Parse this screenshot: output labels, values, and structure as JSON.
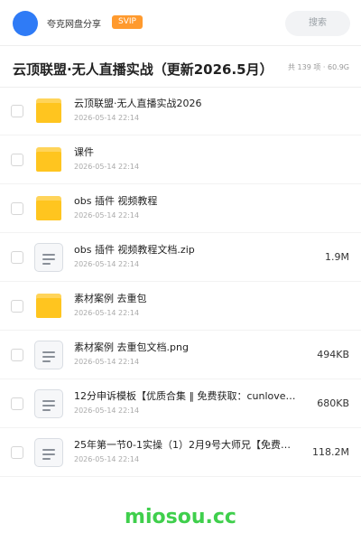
{
  "header": {
    "site_name": "夸克网盘分享",
    "vip_badge": "SVIP",
    "search_placeholder": "搜索"
  },
  "share": {
    "title": "云顶联盟·无人直播实战（更新2026.5月）",
    "meta": "共 139 项 · 60.9G"
  },
  "files": [
    {
      "name": "云顶联盟·无人直播实战2026",
      "time": "2026-05-14 22:14",
      "size": "",
      "type": "folder"
    },
    {
      "name": "课件",
      "time": "2026-05-14 22:14",
      "size": "",
      "type": "folder"
    },
    {
      "name": "obs 插件 视频教程",
      "time": "2026-05-14 22:14",
      "size": "",
      "type": "folder"
    },
    {
      "name": "obs 插件 视频教程文档.zip",
      "time": "2026-05-14 22:14",
      "size": "1.9M",
      "type": "doc"
    },
    {
      "name": "素材案例 去重包",
      "time": "2026-05-14 22:14",
      "size": "",
      "type": "folder"
    },
    {
      "name": "素材案例 去重包文档.png",
      "time": "2026-05-14 22:14",
      "size": "494KB",
      "type": "doc"
    },
    {
      "name": "12分申诉模板【优质合集 ‖ 免费获取：cunlove…",
      "time": "2026-05-14 22:14",
      "size": "680KB",
      "type": "doc"
    },
    {
      "name": "25年第一节0-1实操（1）2月9号大师兄【免费分…",
      "time": "2026-05-14 22:14",
      "size": "118.2M",
      "type": "doc"
    }
  ],
  "watermark": "miosou.cc",
  "colors": {
    "accent": "#2f7bf6",
    "vip": "#ff9a2e",
    "folder": "#ffc51f",
    "watermark": "#3fcf4c"
  }
}
